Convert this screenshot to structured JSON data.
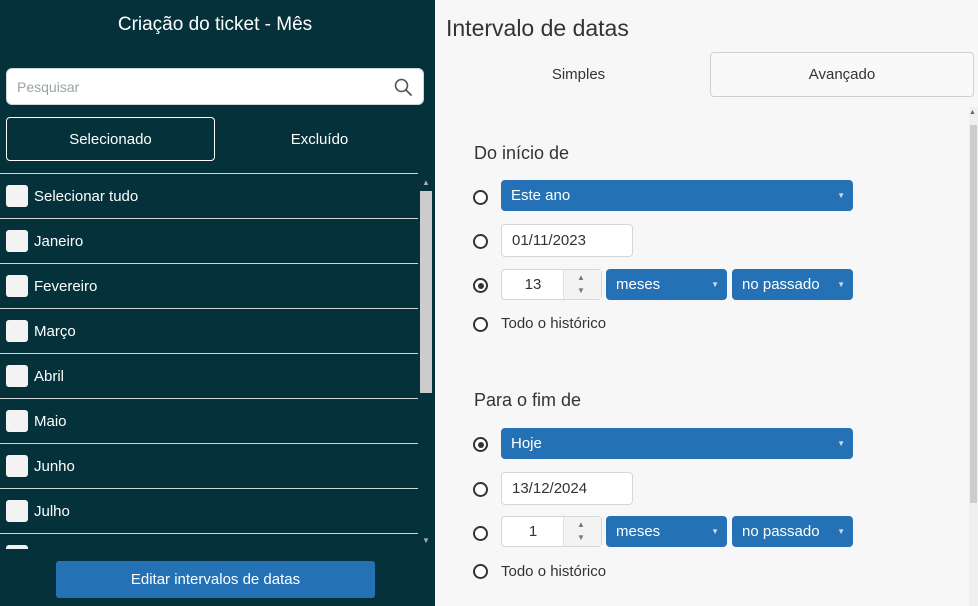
{
  "left": {
    "title": "Criação do ticket - Mês",
    "search": {
      "placeholder": "Pesquisar",
      "value": ""
    },
    "mode_tabs": [
      "Selecionado",
      "Excluído"
    ],
    "items": [
      "Selecionar tudo",
      "Janeiro",
      "Fevereiro",
      "Março",
      "Abril",
      "Maio",
      "Junho",
      "Julho"
    ],
    "edit_button": "Editar intervalos de datas"
  },
  "right": {
    "title": "Intervalo de datas",
    "tabs": [
      "Simples",
      "Avançado"
    ],
    "start": {
      "title": "Do início de",
      "preset": "Este ano",
      "date": "01/11/2023",
      "count": "13",
      "unit": "meses",
      "direction": "no passado",
      "all_history": "Todo o histórico"
    },
    "end": {
      "title": "Para o fim de",
      "preset": "Hoje",
      "date": "13/12/2024",
      "count": "1",
      "unit": "meses",
      "direction": "no passado",
      "all_history": "Todo o histórico"
    }
  },
  "colors": {
    "panel": "#04313a",
    "accent": "#2472b5",
    "background": "#f7f7f7"
  }
}
